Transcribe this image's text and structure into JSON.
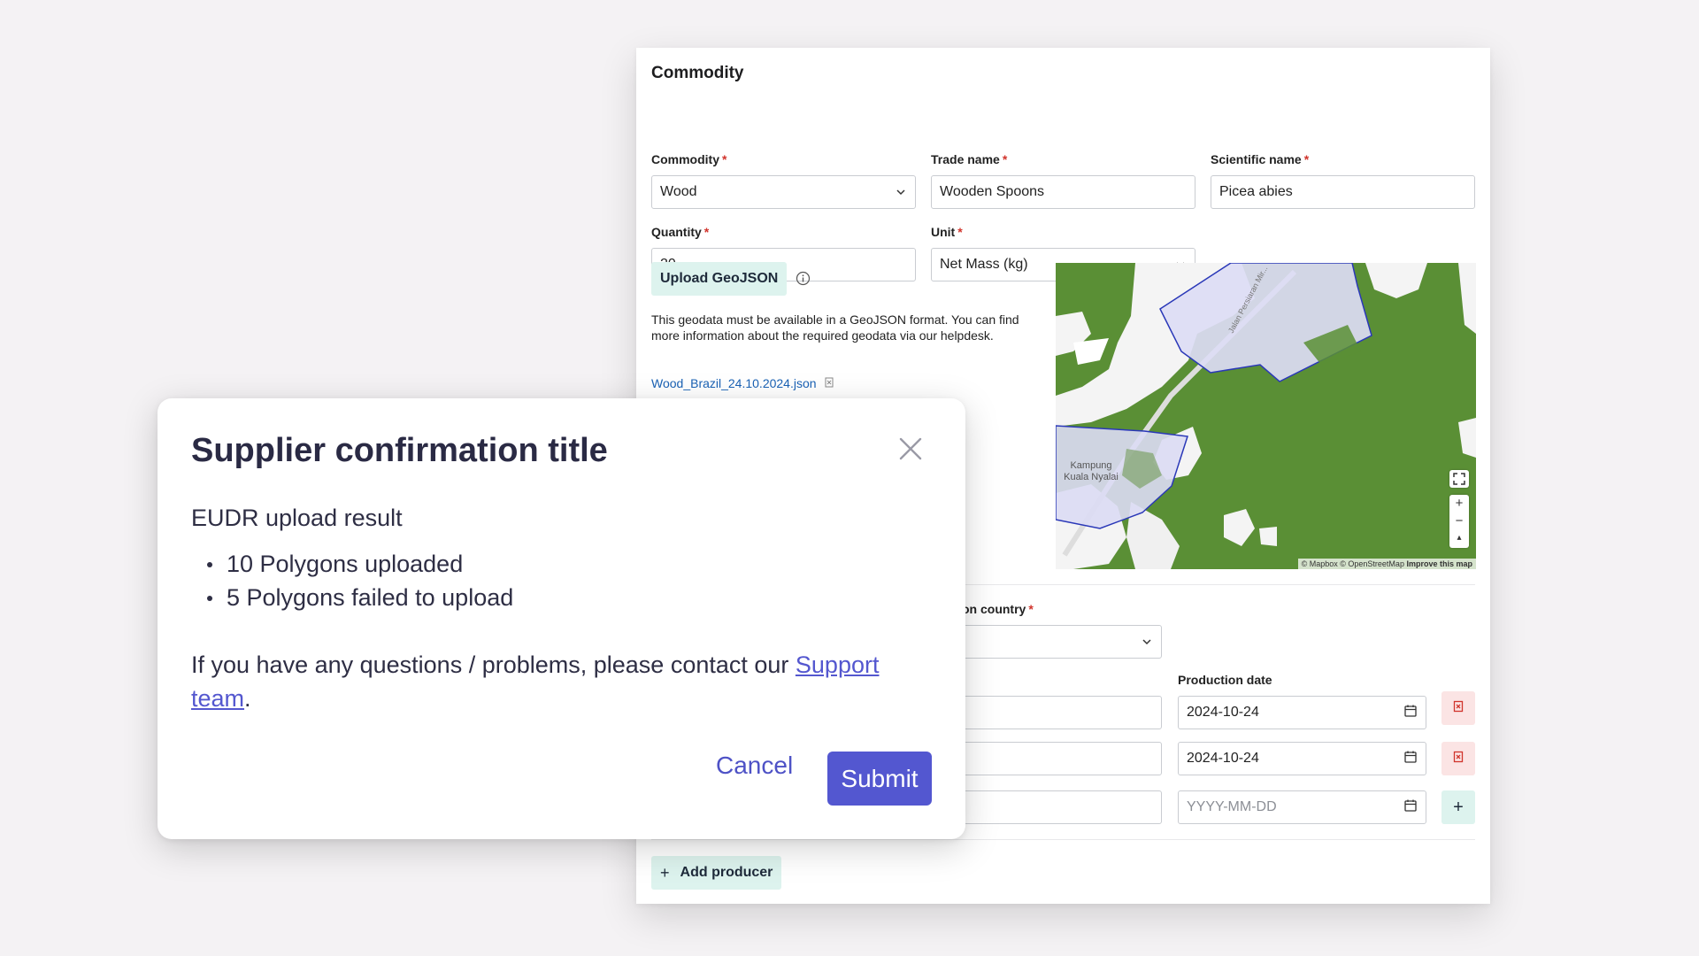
{
  "form": {
    "section_title": "Commodity",
    "commodity": {
      "label": "Commodity",
      "value": "Wood"
    },
    "trade_name": {
      "label": "Trade name",
      "value": "Wooden Spoons"
    },
    "scientific_name": {
      "label": "Scientific name",
      "value": "Picea abies"
    },
    "quantity": {
      "label": "Quantity",
      "value": "20"
    },
    "unit": {
      "label": "Unit",
      "value": "Net Mass (kg)"
    },
    "required_marker": "*",
    "upload_label": "Upload GeoJSON",
    "upload_description": "This geodata must be available in a GeoJSON format. You can find more information about the required geodata via our helpdesk.",
    "uploaded_file": "Wood_Brazil_24.10.2024.json",
    "map": {
      "attribution_1": "© Mapbox © OpenStreetMap",
      "attribution_2": "Improve this map",
      "road_label": "Jalan Persiaran Mir...",
      "place_label_1": "Kampung",
      "place_label_2": "Kuala Nyalai",
      "zoom_in": "+",
      "zoom_out": "−",
      "compass": "▴"
    },
    "production_country_label_partial": "on country",
    "partial_label_2": ")",
    "production_date_label": "Production date",
    "production_dates": [
      "2024-10-24",
      "2024-10-24",
      "YYYY-MM-DD"
    ],
    "add_row_symbol": "+",
    "add_producer_label": "Add producer",
    "add_producer_symbol": "+"
  },
  "modal": {
    "title": "Supplier confirmation title",
    "subtitle": "EUDR upload result",
    "results": [
      "10 Polygons uploaded",
      "5 Polygons failed to upload"
    ],
    "contact_text": "If you have any questions / problems, please contact our ",
    "support_link": "Support team",
    "contact_end": ".",
    "cancel_label": "Cancel",
    "submit_label": "Submit"
  },
  "colors": {
    "accent": "#5357d0",
    "mint": "#ddf3ee",
    "danger_bg": "#fbe4e4",
    "forest": "#578c34",
    "polygon": "#dcdcf4"
  }
}
